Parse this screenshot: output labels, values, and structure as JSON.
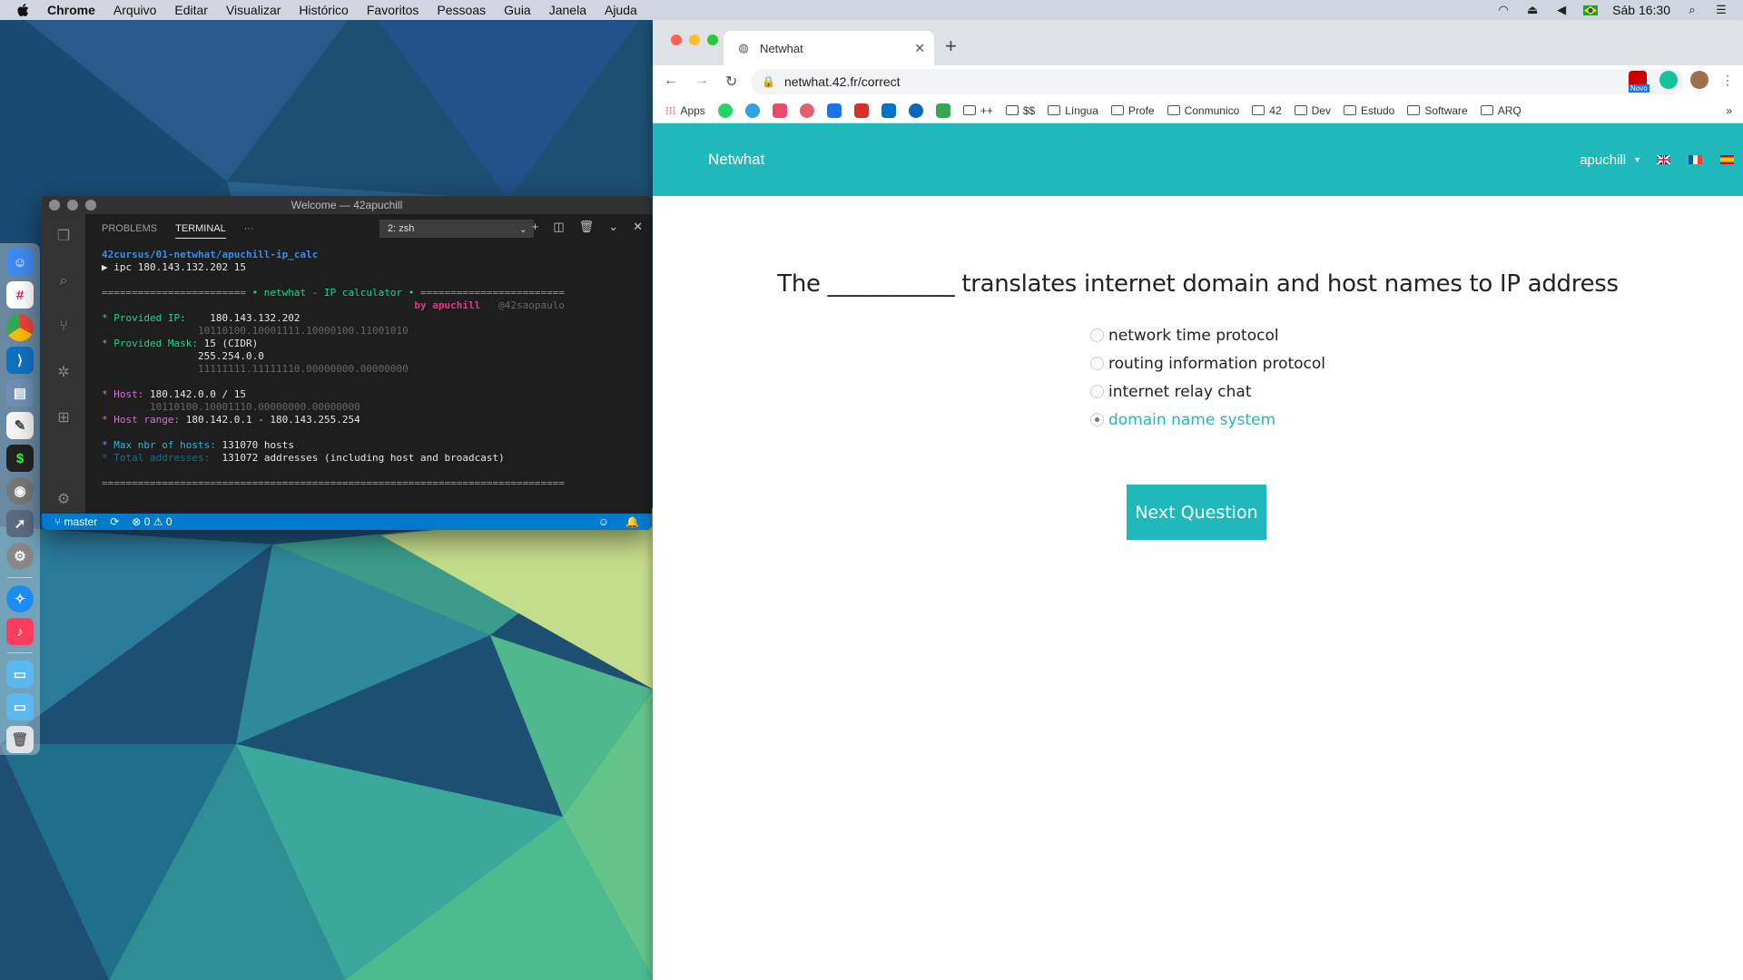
{
  "menubar": {
    "app_name": "Chrome",
    "menus": [
      "Arquivo",
      "Editar",
      "Visualizar",
      "Histórico",
      "Favoritos",
      "Pessoas",
      "Guia",
      "Janela",
      "Ajuda"
    ],
    "clock": "Sáb 16:30"
  },
  "vscode": {
    "window_title": "Welcome — 42apuchill",
    "tabs": [
      "PROBLEMS",
      "TERMINAL"
    ],
    "more": "···",
    "terminal_select": "2: zsh",
    "terminal": {
      "path": "42cursus/01-netwhat/apuchill-ip_calc",
      "command": "▶ ipc 180.143.132.202 15",
      "banner_line": "======================== • netwhat - IP calculator • ========================",
      "by_label": "by apuchill",
      "handle": "@42saopaulo",
      "provided_ip_label": "* Provided IP:",
      "provided_ip": "180.143.132.202",
      "provided_ip_bin": "10110100.10001111.10000100.11001010",
      "provided_mask_label": "* Provided Mask:",
      "provided_mask": "15 (CIDR)",
      "provided_mask_dec": "255.254.0.0",
      "provided_mask_bin": "11111111.11111110.00000000.00000000",
      "host_label": "* Host:",
      "host": "180.142.0.0 / 15",
      "host_bin": "10110100.10001110.00000000.00000000",
      "host_range_label": "* Host range:",
      "host_range": "180.142.0.1 - 180.143.255.254",
      "max_hosts_label": "* Max nbr of hosts:",
      "max_hosts": "131070 hosts",
      "total_label": "* Total addresses:",
      "total": "131072 addresses (including host and broadcast)",
      "footer_line": "============================================================================="
    },
    "status": {
      "branch": "master",
      "errors": "0",
      "warnings": "0"
    }
  },
  "chrome": {
    "tab_title": "Netwhat",
    "url": "netwhat.42.fr/correct",
    "extension_badge": "Novo",
    "bookmarks": [
      {
        "label": "Apps",
        "type": "apps"
      },
      {
        "label": "++",
        "type": "folder"
      },
      {
        "label": "$$",
        "type": "folder"
      },
      {
        "label": "Língua",
        "type": "folder"
      },
      {
        "label": "Profe",
        "type": "folder"
      },
      {
        "label": "Conmunico",
        "type": "folder"
      },
      {
        "label": "42",
        "type": "folder"
      },
      {
        "label": "Dev",
        "type": "folder"
      },
      {
        "label": "Estudo",
        "type": "folder"
      },
      {
        "label": "Software",
        "type": "folder"
      },
      {
        "label": "ARQ",
        "type": "folder"
      }
    ],
    "bookmark_icon_colors": [
      "#25d366",
      "#2aa3e8",
      "#e84c6a",
      "#e4606d",
      "#1a73e8",
      "#d93025",
      "#0072c6",
      "#0a66c2",
      "#34a853"
    ]
  },
  "site": {
    "brand": "Netwhat",
    "user": "apuchill",
    "question": "The ___________ translates internet domain and host names to IP address",
    "options": [
      {
        "label": "network time protocol",
        "selected": false
      },
      {
        "label": "routing information protocol",
        "selected": false
      },
      {
        "label": "internet relay chat",
        "selected": false
      },
      {
        "label": "domain name system",
        "selected": true
      }
    ],
    "next_button": "Next Question",
    "accent_color": "#20b9bb"
  }
}
